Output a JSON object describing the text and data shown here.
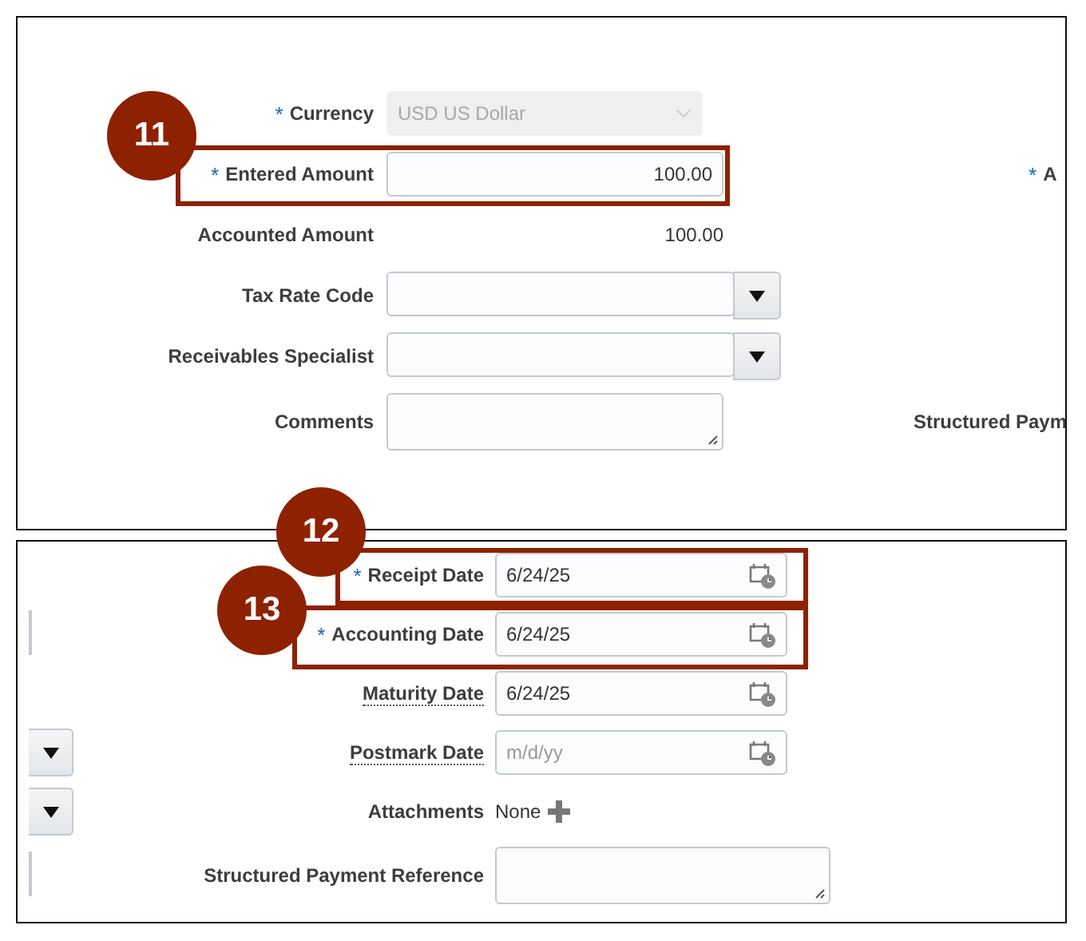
{
  "panels": [
    {
      "rows": [
        {
          "kind": "select",
          "label": "Currency",
          "required_mark": "*",
          "value": "USD US Dollar",
          "disabled": true
        },
        {
          "kind": "input",
          "label": "Entered Amount",
          "required_mark": "*",
          "value": "100.00",
          "side_label": {
            "text": "A",
            "required_mark": "*"
          }
        },
        {
          "kind": "readonly",
          "label": "Accounted Amount",
          "value": "100.00"
        },
        {
          "kind": "dropdown",
          "label": "Tax Rate Code"
        },
        {
          "kind": "dropdown",
          "label": "Receivables Specialist"
        },
        {
          "kind": "textarea",
          "label": "Comments",
          "side_label": {
            "text": "Structured Paym"
          }
        }
      ]
    },
    {
      "rows": [
        {
          "kind": "date",
          "label": "Receipt Date",
          "required_mark": "*",
          "underlined": false,
          "value": "6/24/25"
        },
        {
          "kind": "date",
          "label": "Accounting Date",
          "required_mark": "*",
          "underlined": false,
          "value": "6/24/25",
          "left_stub": {
            "kind": "field"
          }
        },
        {
          "kind": "date",
          "label": "Maturity Date",
          "underlined": true,
          "value": "6/24/25"
        },
        {
          "kind": "date",
          "label": "Postmark Date",
          "underlined": true,
          "placeholder": "m/d/yy",
          "left_stub": {
            "kind": "dropdown"
          }
        },
        {
          "kind": "attachments",
          "label": "Attachments",
          "underlined": false,
          "value": "None",
          "left_stub": {
            "kind": "dropdown"
          }
        },
        {
          "kind": "textarea",
          "label": "Structured Payment Reference",
          "underlined": false,
          "left_stub": {
            "kind": "field"
          }
        }
      ]
    }
  ],
  "callouts": [
    {
      "number": "11"
    },
    {
      "number": "12"
    },
    {
      "number": "13"
    }
  ]
}
